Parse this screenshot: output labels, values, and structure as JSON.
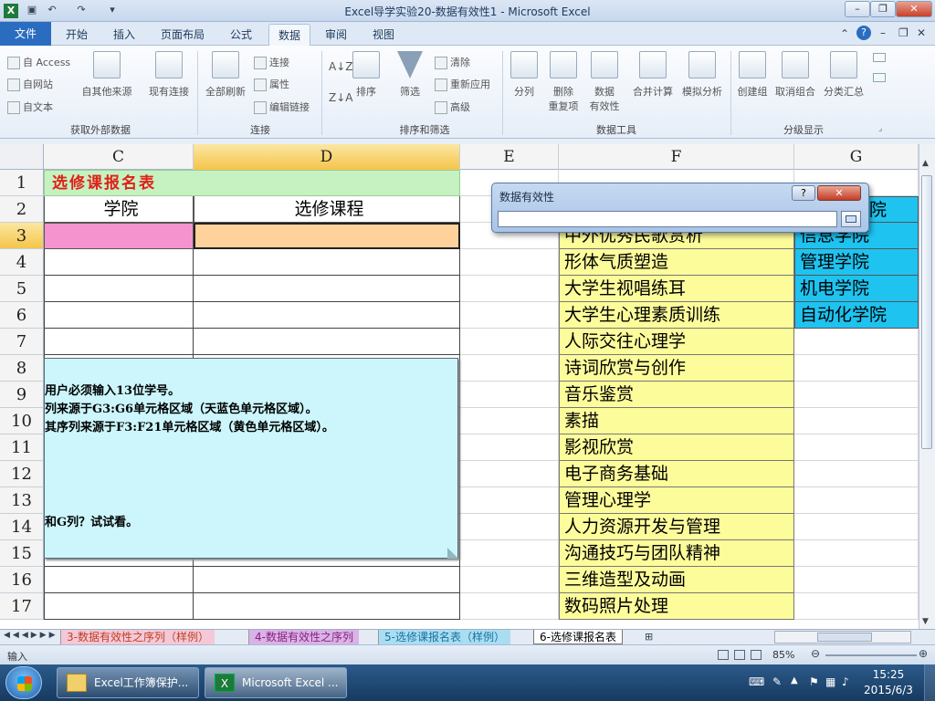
{
  "window": {
    "title": "Excel导学实验20-数据有效性1 - Microsoft Excel"
  },
  "menu": {
    "file": "文件",
    "tabs": [
      "开始",
      "插入",
      "页面布局",
      "公式",
      "数据",
      "审阅",
      "视图"
    ],
    "active_tab": "数据"
  },
  "ribbon": {
    "get_external": {
      "from_access": "自 Access",
      "from_web": "自网站",
      "from_text": "自文本",
      "from_other": "自其他来源",
      "existing": "现有连接",
      "label": "获取外部数据"
    },
    "connections": {
      "refresh_all": "全部刷新",
      "connections": "连接",
      "properties": "属性",
      "edit_links": "编辑链接",
      "label": "连接"
    },
    "sort_filter": {
      "sort": "排序",
      "filter": "筛选",
      "clear": "清除",
      "reapply": "重新应用",
      "advanced": "高级",
      "label": "排序和筛选"
    },
    "data_tools": {
      "text_to_columns": "分列",
      "remove_dup_1": "删除",
      "remove_dup_2": "重复项",
      "validation_1": "数据",
      "validation_2": "有效性",
      "consolidate": "合并计算",
      "what_if": "模拟分析",
      "label": "数据工具"
    },
    "outline": {
      "group": "创建组",
      "ungroup": "取消组合",
      "subtotal": "分类汇总",
      "label": "分级显示"
    }
  },
  "columns": [
    "C",
    "D",
    "E",
    "F",
    "G"
  ],
  "rows": [
    "1",
    "2",
    "3",
    "4",
    "5",
    "6",
    "7",
    "8",
    "9",
    "10",
    "11",
    "12",
    "13",
    "14",
    "15",
    "16",
    "17"
  ],
  "sheet": {
    "title": "选修课报名表",
    "header_c": "学院",
    "header_d": "选修课程",
    "header_g": "院",
    "courses": [
      "中外优秀民歌赏析",
      "形体气质塑造",
      "大学生视唱练耳",
      "大学生心理素质训练",
      "人际交往心理学",
      "诗词欣赏与创作",
      "音乐鉴赏",
      "素描",
      "影视欣赏",
      "电子商务基础",
      "管理心理学",
      "人力资源开发与管理",
      "沟通技巧与团队精神",
      "三维造型及动画",
      "数码照片处理"
    ],
    "colleges": [
      "信息学院",
      "管理学院",
      "机电学院",
      "自动化学院"
    ]
  },
  "note": {
    "lines": [
      "用户必须输入13位学号。",
      "列来源于G3:G6单元格区域（天蓝色单元格区域）。",
      "其序列来源于F3:F21单元格区域（黄色单元格区域）。",
      "和G列？试试看。"
    ]
  },
  "dialog": {
    "title": "数据有效性",
    "help": "?",
    "close": "✕",
    "input_value": ""
  },
  "sheet_tabs": [
    "3-数据有效性之序列（样例）",
    "4-数据有效性之序列",
    "5-选修课报名表（样例）",
    "6-选修课报名表"
  ],
  "active_sheet": "6-选修课报名表",
  "status": {
    "mode": "输入",
    "zoom": "85%"
  },
  "taskbar": {
    "item1": "Excel工作簿保护...",
    "item2": "Microsoft Excel ...",
    "time": "15:25",
    "date": "2015/6/3"
  },
  "colors": {
    "yellow": "#fdfc9b",
    "skyblue": "#1ec3f0",
    "green_header": "#c6f1c0",
    "pink": "#f593cf",
    "orange": "#ffd29c",
    "title_red": "#e0201a"
  }
}
